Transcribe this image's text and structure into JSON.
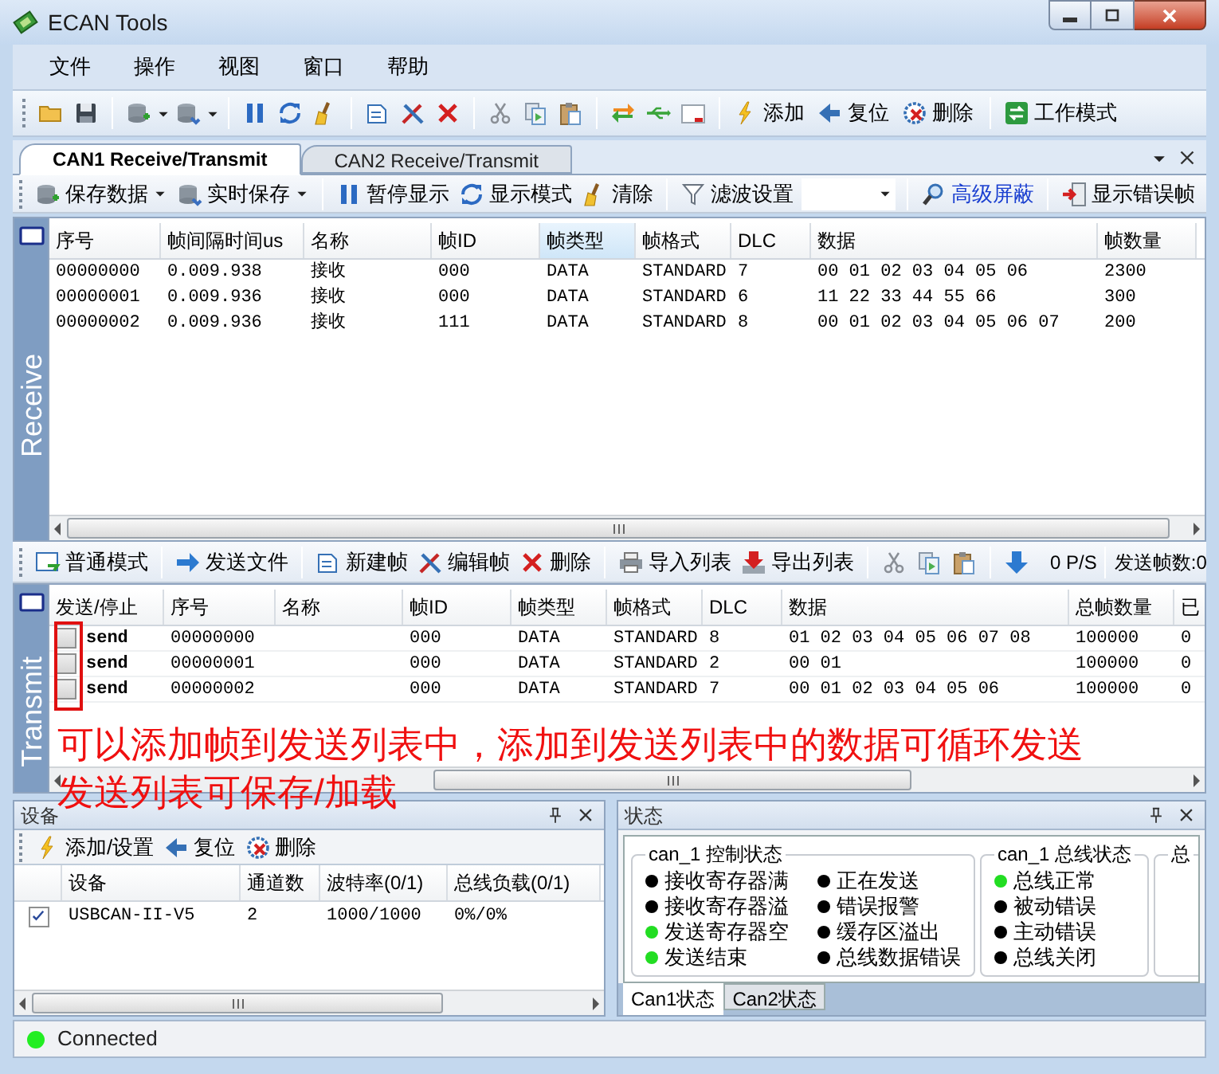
{
  "window": {
    "title": "ECAN Tools"
  },
  "menu": [
    "文件",
    "操作",
    "视图",
    "窗口",
    "帮助"
  ],
  "toolbar": {
    "buttons": [
      "添加",
      "复位",
      "删除",
      "工作模式"
    ]
  },
  "tabs": [
    {
      "label": "CAN1 Receive/Transmit",
      "selected": true
    },
    {
      "label": "CAN2 Receive/Transmit",
      "selected": false
    }
  ],
  "receive_toolbar": [
    {
      "label": "保存数据",
      "kind": "menu"
    },
    {
      "label": "实时保存",
      "kind": "menu"
    },
    {
      "label": "暂停显示",
      "kind": "button"
    },
    {
      "label": "显示模式",
      "kind": "button"
    },
    {
      "label": "清除",
      "kind": "button"
    },
    {
      "label": "滤波设置",
      "kind": "button"
    },
    {
      "kind": "combo"
    },
    {
      "label": "高级屏蔽",
      "kind": "link"
    },
    {
      "label": "显示错误帧",
      "kind": "button"
    }
  ],
  "receive": {
    "side_label": "Receive",
    "columns": [
      {
        "label": "序号",
        "highlighted": false
      },
      {
        "label": "帧间隔时间us",
        "highlighted": false
      },
      {
        "label": "名称",
        "highlighted": false
      },
      {
        "label": "帧ID",
        "highlighted": false
      },
      {
        "label": "帧类型",
        "highlighted": true
      },
      {
        "label": "帧格式",
        "highlighted": false
      },
      {
        "label": "DLC",
        "highlighted": false
      },
      {
        "label": "数据",
        "highlighted": false
      },
      {
        "label": "帧数量",
        "highlighted": false
      }
    ],
    "rows": [
      [
        "00000000",
        "0.009.938",
        "接收",
        "000",
        "DATA",
        "STANDARD",
        "7",
        "00 01 02 03 04 05 06",
        "2300"
      ],
      [
        "00000001",
        "0.009.936",
        "接收",
        "000",
        "DATA",
        "STANDARD",
        "6",
        "11 22 33 44 55 66",
        "300"
      ],
      [
        "00000002",
        "0.009.936",
        "接收",
        "111",
        "DATA",
        "STANDARD",
        "8",
        "00 01 02 03 04 05 06 07",
        "200"
      ]
    ]
  },
  "transmit_toolbar": {
    "buttons": [
      "普通模式",
      "发送文件",
      "新建帧",
      "编辑帧",
      "删除",
      "导入列表",
      "导出列表"
    ],
    "rate": "0 P/S",
    "sent_count": "发送帧数:0"
  },
  "transmit": {
    "side_label": "Transmit",
    "columns": [
      "发送/停止",
      "序号",
      "名称",
      "帧ID",
      "帧类型",
      "帧格式",
      "DLC",
      "数据",
      "总帧数量",
      "已"
    ],
    "rows": [
      {
        "checked": false,
        "action": "send",
        "seq": "00000000",
        "frame_id": "000",
        "frame_type": "DATA",
        "frame_format": "STANDARD",
        "dlc": "8",
        "data": "01 02 03 04 05 06 07 08",
        "total": "100000",
        "column_10": "0"
      },
      {
        "checked": false,
        "action": "send",
        "seq": "00000001",
        "frame_id": "000",
        "frame_type": "DATA",
        "frame_format": "STANDARD",
        "dlc": "2",
        "data": "00 01",
        "total": "100000",
        "column_10": "0"
      },
      {
        "checked": false,
        "action": "send",
        "seq": "00000002",
        "frame_id": "000",
        "frame_type": "DATA",
        "frame_format": "STANDARD",
        "dlc": "7",
        "data": "00 01 02 03 04 05 06",
        "total": "100000",
        "column_10": "0"
      }
    ]
  },
  "annotation": [
    "可以添加帧到发送列表中，添加到发送列表中的数据可循环发送",
    "发送列表可保存/加载"
  ],
  "device_panel": {
    "title": "设备",
    "toolbar": [
      "添加/设置",
      "复位",
      "删除"
    ],
    "columns": [
      "设备",
      "通道数",
      "波特率(0/1)",
      "总线负载(0/1)"
    ],
    "rows": [
      {
        "checked": true,
        "cells": [
          "USBCAN-II-V5",
          "2",
          "1000/1000",
          "0%/0%"
        ]
      }
    ]
  },
  "status_panel": {
    "title": "状态",
    "groups": [
      {
        "title": "can_1 控制状态",
        "items": [
          {
            "label": "接收寄存器满",
            "color": "#000000"
          },
          {
            "label": "接收寄存器溢",
            "color": "#000000"
          },
          {
            "label": "发送寄存器空",
            "color": "#22dd22"
          },
          {
            "label": "发送结束",
            "color": "#22dd22"
          },
          {
            "label": "正在发送",
            "color": "#000000"
          },
          {
            "label": "错误报警",
            "color": "#000000"
          },
          {
            "label": "缓存区溢出",
            "color": "#000000"
          },
          {
            "label": "总线数据错误",
            "color": "#000000"
          }
        ]
      },
      {
        "title": "can_1 总线状态",
        "items": [
          {
            "label": "总线正常",
            "color": "#22dd22"
          },
          {
            "label": "被动错误",
            "color": "#000000"
          },
          {
            "label": "主动错误",
            "color": "#000000"
          },
          {
            "label": "总线关闭",
            "color": "#000000"
          }
        ]
      },
      {
        "title": "总"
      }
    ],
    "tabs": [
      {
        "label": "Can1状态",
        "selected": true
      },
      {
        "label": "Can2状态",
        "selected": false
      }
    ]
  },
  "status_bar": {
    "text": "Connected",
    "connected": true
  }
}
